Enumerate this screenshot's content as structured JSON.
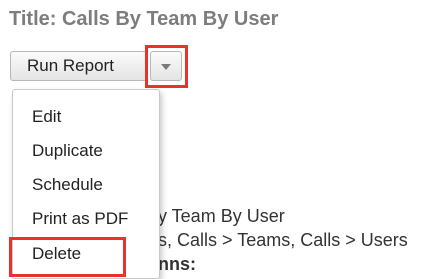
{
  "report": {
    "title": "Title: Calls By Team By User",
    "run_report_label": "Run Report"
  },
  "dropdown": {
    "toggle_icon": "chevron-down-icon"
  },
  "menu": {
    "items": [
      {
        "label": "Edit"
      },
      {
        "label": "Duplicate"
      },
      {
        "label": "Schedule"
      },
      {
        "label": "Print as PDF"
      },
      {
        "label": "Delete"
      }
    ]
  },
  "background_text": {
    "line1": "y Team By User",
    "line2": "s, Calls > Teams, Calls > Users",
    "line3": "nns:"
  },
  "colors": {
    "highlight": "#e8322d",
    "title": "#7d7d7d"
  }
}
